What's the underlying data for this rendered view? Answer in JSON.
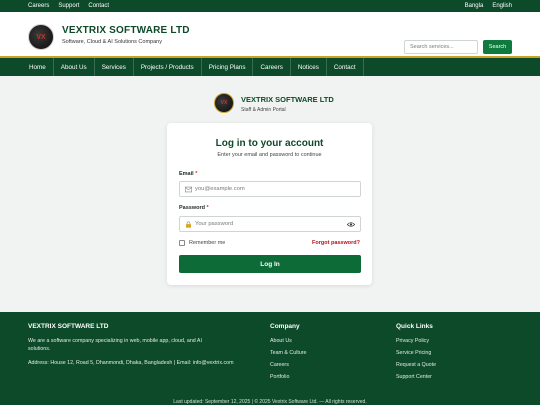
{
  "topbar": {
    "left_links": [
      "Careers",
      "Support",
      "Contact"
    ],
    "right_links": [
      "Bangla",
      "English"
    ]
  },
  "header": {
    "logo_text": "VX",
    "title": "VEXTRIX SOFTWARE LTD",
    "subtitle": "Software, Cloud & AI Solutions Company",
    "search_placeholder": "Search services...",
    "search_button": "Search"
  },
  "nav": {
    "items": [
      "Home",
      "About Us",
      "Services",
      "Projects / Products",
      "Pricing Plans",
      "Careers",
      "Notices",
      "Contact"
    ]
  },
  "portal": {
    "logo_text": "VX",
    "title": "VEXTRIX SOFTWARE LTD",
    "subtitle": "Staff & Admin Portal"
  },
  "login": {
    "title": "Log in to your account",
    "subtitle": "Enter your email and password to continue",
    "email_label": "Email",
    "email_placeholder": "you@example.com",
    "password_label": "Password",
    "password_placeholder": "Your password",
    "required_mark": "*",
    "remember_label": "Remember me",
    "forgot_label": "Forgot password?",
    "submit_label": "Log In"
  },
  "footer": {
    "company_title": "VEXTRIX SOFTWARE LTD",
    "description": "We are a software company specializing in web, mobile app, cloud, and AI solutions.",
    "address": "Address: House 12, Road 5, Dhanmondi, Dhaka, Bangladesh | Email: info@vextrix.com",
    "company_heading": "Company",
    "company_links": [
      "About Us",
      "Team & Culture",
      "Careers",
      "Portfolio"
    ],
    "quick_heading": "Quick Links",
    "quick_links": [
      "Privacy Policy",
      "Service Pricing",
      "Request a Quote",
      "Support Center"
    ],
    "bottom_text": "Last updated: September 12, 2025 | © 2025 Vextrix Software Ltd. — All rights reserved."
  },
  "colors": {
    "brand_green": "#0d4a2a",
    "button_green": "#0e7a3e",
    "accent_gold": "#c9a227",
    "link_red": "#b5121b"
  }
}
